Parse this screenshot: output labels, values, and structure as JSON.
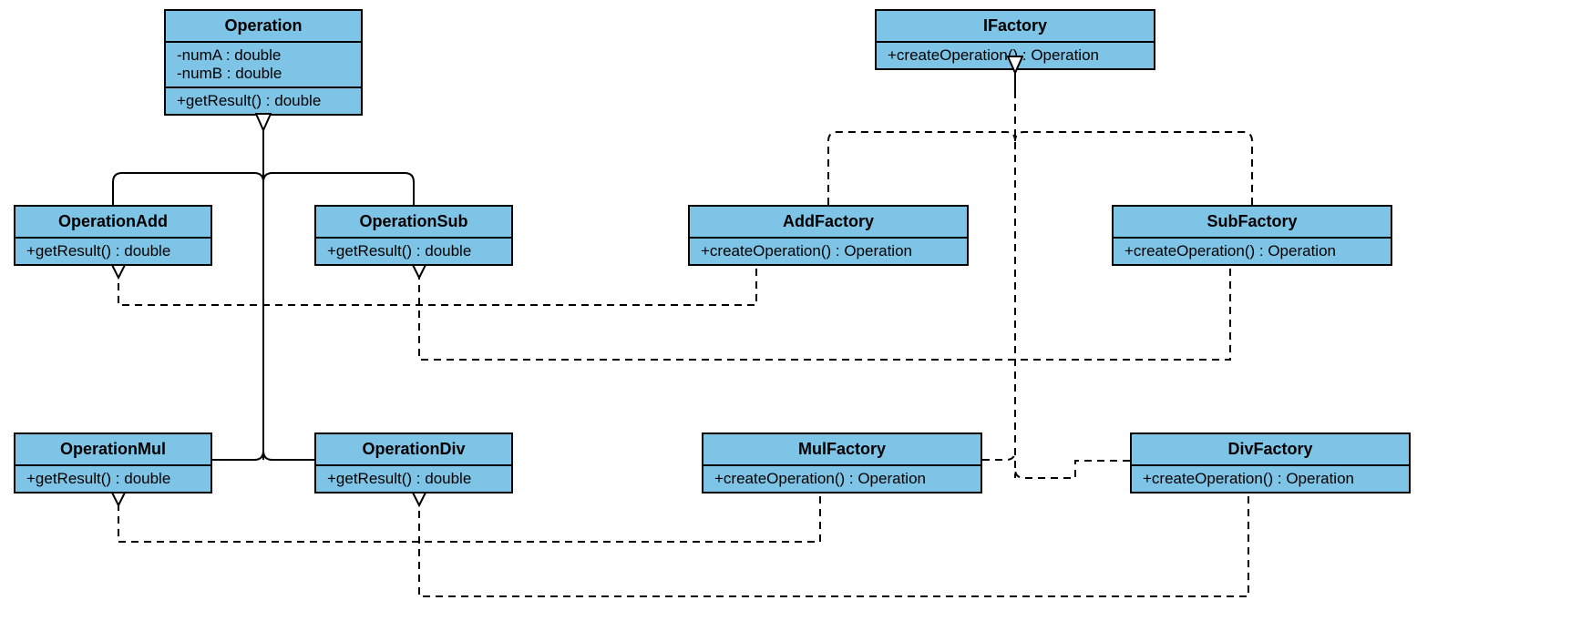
{
  "classes": {
    "operation": {
      "name": "Operation",
      "attrs": [
        "-numA : double",
        "-numB : double"
      ],
      "ops": [
        "+getResult() : double"
      ]
    },
    "operationAdd": {
      "name": "OperationAdd",
      "ops": [
        "+getResult() : double"
      ]
    },
    "operationSub": {
      "name": "OperationSub",
      "ops": [
        "+getResult() : double"
      ]
    },
    "operationMul": {
      "name": "OperationMul",
      "ops": [
        "+getResult() : double"
      ]
    },
    "operationDiv": {
      "name": "OperationDiv",
      "ops": [
        "+getResult() : double"
      ]
    },
    "ifactory": {
      "name": "IFactory",
      "ops": [
        "+createOperation() : Operation"
      ]
    },
    "addFactory": {
      "name": "AddFactory",
      "ops": [
        "+createOperation() : Operation"
      ]
    },
    "subFactory": {
      "name": "SubFactory",
      "ops": [
        "+createOperation() : Operation"
      ]
    },
    "mulFactory": {
      "name": "MulFactory",
      "ops": [
        "+createOperation() : Operation"
      ]
    },
    "divFactory": {
      "name": "DivFactory",
      "ops": [
        "+createOperation() : Operation"
      ]
    }
  },
  "relations": {
    "inheritance_solid": [
      {
        "from": "operationAdd",
        "to": "operation"
      },
      {
        "from": "operationSub",
        "to": "operation"
      },
      {
        "from": "operationMul",
        "to": "operation"
      },
      {
        "from": "operationDiv",
        "to": "operation"
      }
    ],
    "inheritance_dashed": [
      {
        "from": "addFactory",
        "to": "ifactory"
      },
      {
        "from": "subFactory",
        "to": "ifactory"
      },
      {
        "from": "mulFactory",
        "to": "ifactory"
      },
      {
        "from": "divFactory",
        "to": "ifactory"
      }
    ],
    "dependency_dashed": [
      {
        "from": "addFactory",
        "to": "operationAdd"
      },
      {
        "from": "subFactory",
        "to": "operationSub"
      },
      {
        "from": "mulFactory",
        "to": "operationMul"
      },
      {
        "from": "divFactory",
        "to": "operationDiv"
      }
    ]
  }
}
